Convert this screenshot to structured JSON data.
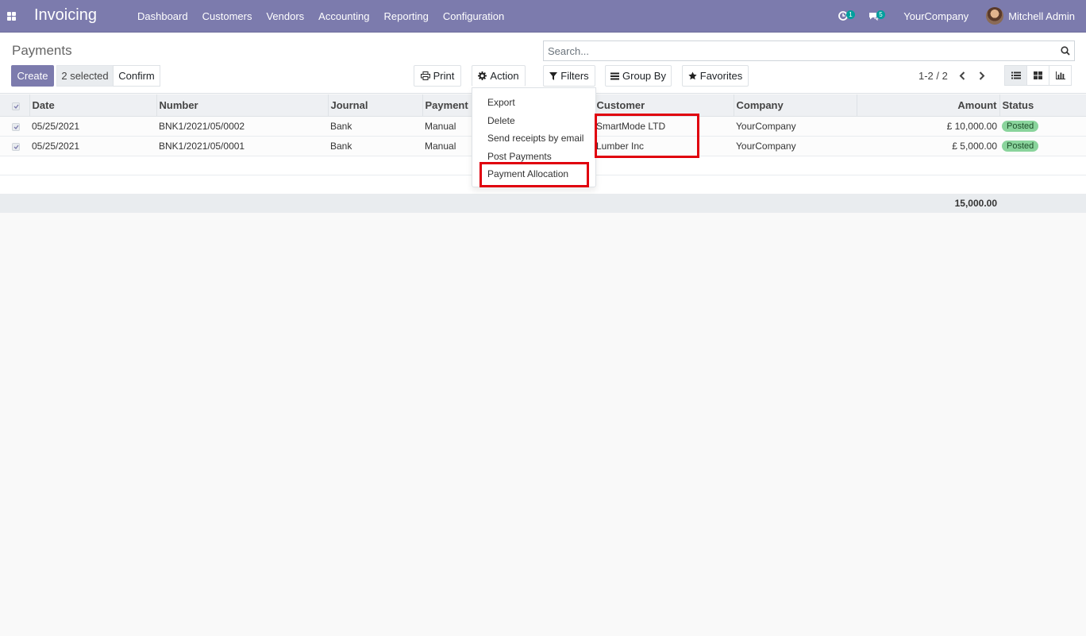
{
  "navbar": {
    "brand": "Invoicing",
    "menu": [
      "Dashboard",
      "Customers",
      "Vendors",
      "Accounting",
      "Reporting",
      "Configuration"
    ],
    "activities_count": "1",
    "messages_count": "5",
    "company": "YourCompany",
    "user": "Mitchell Admin"
  },
  "control_panel": {
    "title": "Payments",
    "search_placeholder": "Search...",
    "create_label": "Create",
    "selected_label": "2 selected",
    "confirm_label": "Confirm",
    "print_label": "Print",
    "action_label": "Action",
    "filters_label": "Filters",
    "groupby_label": "Group By",
    "favorites_label": "Favorites",
    "pager": "1-2 / 2"
  },
  "action_menu": {
    "items": [
      "Export",
      "Delete",
      "Send receipts by email",
      "Post Payments",
      "Payment Allocation"
    ]
  },
  "table": {
    "columns": [
      "Date",
      "Number",
      "Journal",
      "Payment M",
      "Customer",
      "Company",
      "Amount",
      "Status"
    ],
    "rows": [
      {
        "date": "05/25/2021",
        "number": "BNK1/2021/05/0002",
        "journal": "Bank",
        "method": "Manual",
        "customer": "SmartMode LTD",
        "company": "YourCompany",
        "amount": "£ 10,000.00",
        "status": "Posted"
      },
      {
        "date": "05/25/2021",
        "number": "BNK1/2021/05/0001",
        "journal": "Bank",
        "method": "Manual",
        "customer": "Lumber Inc",
        "company": "YourCompany",
        "amount": "£ 5,000.00",
        "status": "Posted"
      }
    ],
    "total": "15,000.00"
  },
  "colors": {
    "brand": "#7c7bad",
    "highlight": "#e0000e",
    "posted_badge": "#8ad49c"
  }
}
